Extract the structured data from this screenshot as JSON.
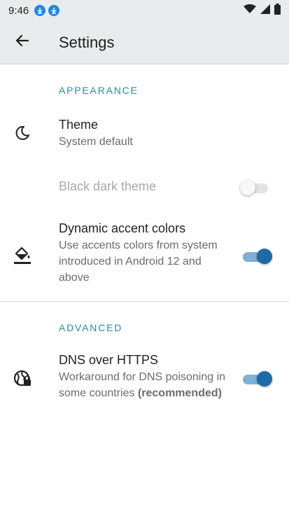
{
  "status_bar": {
    "time": "9:46",
    "icons": [
      "download-icon",
      "download-icon",
      "wifi-icon",
      "signal-icon",
      "battery-icon"
    ]
  },
  "app_bar": {
    "title": "Settings",
    "back_icon": "arrow-back-icon"
  },
  "sections": {
    "appearance": {
      "header": "APPEARANCE",
      "theme": {
        "title": "Theme",
        "summary": "System default",
        "icon": "moon-icon"
      },
      "black_dark_theme": {
        "title": "Black dark theme",
        "enabled": false,
        "checked": false
      },
      "dynamic_colors": {
        "title": "Dynamic accent colors",
        "summary_line1": "Use accents colors from system",
        "summary_line2": "introduced in Android 12 and",
        "summary_line3": "above",
        "checked": true,
        "icon": "paint-bucket-icon"
      }
    },
    "advanced": {
      "header": "ADVANCED",
      "dns": {
        "title": "DNS over HTTPS",
        "summary_line1": "Workaround for DNS poisoning in",
        "summary_line2_prefix": "some countries",
        "summary_line2_bold": "(recommended)",
        "checked": true,
        "icon": "globe-lock-icon"
      }
    }
  },
  "colors": {
    "accent": "#2d8aa0",
    "switch_on": "#1d6aa8",
    "app_bar": "#e9ecec"
  }
}
